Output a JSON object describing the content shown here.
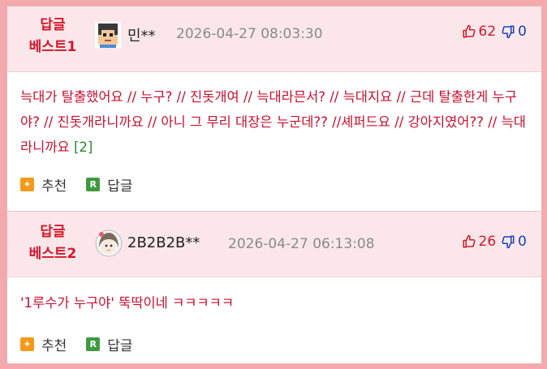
{
  "comments": [
    {
      "best_line1": "답글",
      "best_line2": "베스트1",
      "nickname": "민**",
      "datetime": "2026-04-27 08:03:30",
      "upvotes": "62",
      "downvotes": "0",
      "text": "늑대가 탈출했어요 // 누구? // 진돗개여 // 늑대라믄서? // 늑대지요 // 근데 탈출한게 누구야? // 진돗개라니까요 // 아니 그 무리 대장은 누군데?? //셰퍼드요 // 강아지였어?? // 늑대라니까요",
      "reply_count": "[2]",
      "recommend_label": "추천",
      "reply_label": "답글"
    },
    {
      "best_line1": "답글",
      "best_line2": "베스트2",
      "nickname": "2B2B2B**",
      "datetime": "2026-04-27 06:13:08",
      "upvotes": "26",
      "downvotes": "0",
      "text": "'1루수가 누구야' 뚝딱이네 ㅋㅋㅋㅋㅋ",
      "recommend_label": "추천",
      "reply_label": "답글"
    }
  ],
  "colors": {
    "accent_red": "#d6162a",
    "down_blue": "#1a3fbd",
    "reply_green": "#2b8a2b",
    "header_bg": "#fbe7e9",
    "outer_bg": "#f4a9ad"
  },
  "icons": {
    "thumbs_up": "thumbs-up-icon",
    "thumbs_down": "thumbs-down-icon",
    "recommend": "recommend-icon",
    "reply": "reply-icon"
  }
}
